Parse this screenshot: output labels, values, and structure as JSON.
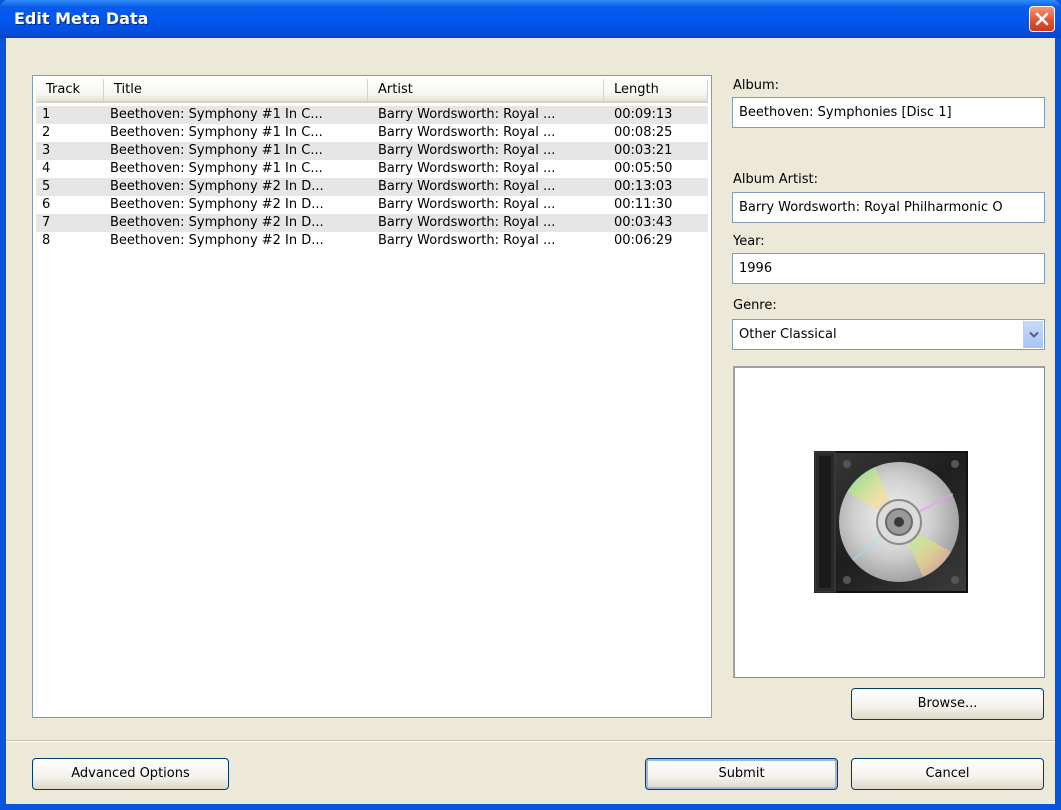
{
  "window": {
    "title": "Edit Meta Data"
  },
  "tracklist": {
    "columns": [
      "Track",
      "Title",
      "Artist",
      "Length"
    ],
    "rows": [
      {
        "track": "1",
        "title": "Beethoven: Symphony #1 In C...",
        "artist": "Barry Wordsworth: Royal ...",
        "length": "00:09:13"
      },
      {
        "track": "2",
        "title": "Beethoven: Symphony #1 In C...",
        "artist": "Barry Wordsworth: Royal ...",
        "length": "00:08:25"
      },
      {
        "track": "3",
        "title": "Beethoven: Symphony #1 In C...",
        "artist": "Barry Wordsworth: Royal ...",
        "length": "00:03:21"
      },
      {
        "track": "4",
        "title": "Beethoven: Symphony #1 In C...",
        "artist": "Barry Wordsworth: Royal ...",
        "length": "00:05:50"
      },
      {
        "track": "5",
        "title": "Beethoven: Symphony #2 In D...",
        "artist": "Barry Wordsworth: Royal ...",
        "length": "00:13:03"
      },
      {
        "track": "6",
        "title": "Beethoven: Symphony #2 In D...",
        "artist": "Barry Wordsworth: Royal ...",
        "length": "00:11:30"
      },
      {
        "track": "7",
        "title": "Beethoven: Symphony #2 In D...",
        "artist": "Barry Wordsworth: Royal ...",
        "length": "00:03:43"
      },
      {
        "track": "8",
        "title": "Beethoven: Symphony #2 In D...",
        "artist": "Barry Wordsworth: Royal ...",
        "length": "00:06:29"
      }
    ]
  },
  "fields": {
    "album_label": "Album:",
    "album_value": "Beethoven: Symphonies [Disc 1]",
    "album_artist_label": "Album Artist:",
    "album_artist_value": "Barry Wordsworth: Royal Philharmonic O",
    "year_label": "Year:",
    "year_value": "1996",
    "genre_label": "Genre:",
    "genre_value": "Other Classical"
  },
  "artwork": {
    "icon": "cd-case-icon",
    "browse_label": "Browse..."
  },
  "footer": {
    "advanced_label": "Advanced Options",
    "submit_label": "Submit",
    "cancel_label": "Cancel"
  },
  "colors": {
    "titlebar": "#0058ee",
    "dialog_bg": "#ece9d8",
    "close_button": "#e2542e",
    "alt_row": "#e6e6e6"
  }
}
